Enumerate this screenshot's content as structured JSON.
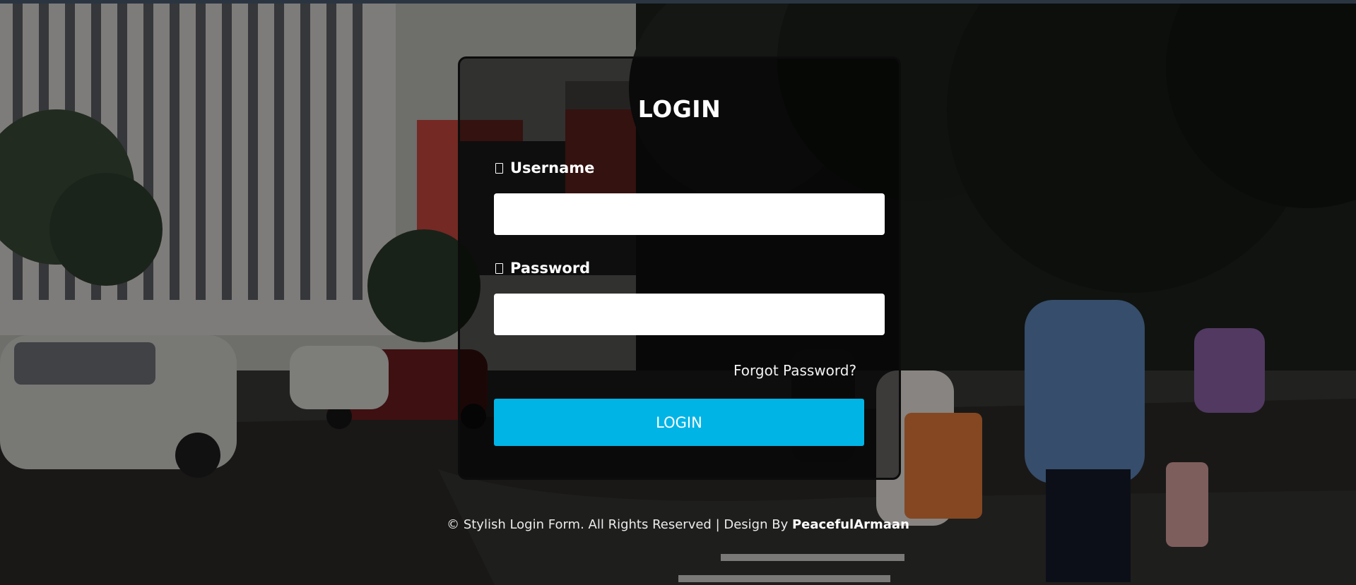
{
  "login": {
    "title": "LOGIN",
    "username_label": "Username",
    "password_label": "Password",
    "username_value": "",
    "password_value": "",
    "forgot_password": "Forgot Password?",
    "submit_label": "LOGIN",
    "icon_user": "user-icon",
    "icon_lock": "lock-icon"
  },
  "footer": {
    "text": "© Stylish Login Form. All Rights Reserved | Design By",
    "brand": "PeacefulArmaan"
  },
  "colors": {
    "accent": "#00b4e6",
    "card_border": "#0c0c0c",
    "text": "#ffffff"
  }
}
